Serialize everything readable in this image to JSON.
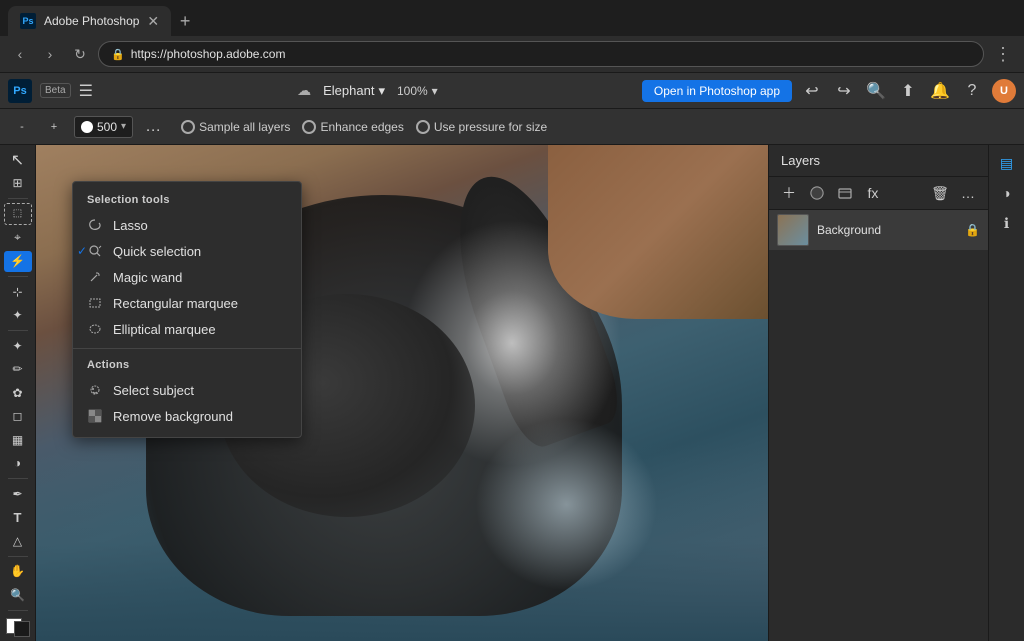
{
  "browser": {
    "tab_title": "Adobe Photoshop",
    "url": "https://photoshop.adobe.com",
    "new_tab_label": "+"
  },
  "header": {
    "ps_label": "Ps",
    "beta_label": "Beta",
    "file_name": "Elephant",
    "zoom_level": "100%",
    "open_app_btn": "Open in Photoshop app",
    "undo_icon": "↩",
    "redo_icon": "↪"
  },
  "toolbar": {
    "brush_size": "500",
    "sample_all_layers": "Sample all layers",
    "enhance_edges": "Enhance edges",
    "use_pressure": "Use pressure for size"
  },
  "selection_dropdown": {
    "section_title": "Selection tools",
    "items": [
      {
        "id": "lasso",
        "label": "Lasso",
        "checked": false
      },
      {
        "id": "quick-selection",
        "label": "Quick selection",
        "checked": true
      },
      {
        "id": "magic-wand",
        "label": "Magic wand",
        "checked": false
      },
      {
        "id": "rect-marquee",
        "label": "Rectangular marquee",
        "checked": false
      },
      {
        "id": "ellip-marquee",
        "label": "Elliptical marquee",
        "checked": false
      }
    ],
    "actions_title": "Actions",
    "actions": [
      {
        "id": "select-subject",
        "label": "Select subject"
      },
      {
        "id": "remove-bg",
        "label": "Remove background"
      }
    ]
  },
  "layers": {
    "title": "Layers",
    "items": [
      {
        "id": "background",
        "label": "Background",
        "locked": true
      }
    ]
  },
  "left_tools": [
    {
      "id": "select",
      "label": "▷",
      "active": false
    },
    {
      "id": "rectangle-select",
      "label": "⬚",
      "active": false
    },
    {
      "id": "lasso",
      "label": "⌖",
      "active": false
    },
    {
      "id": "quick-select",
      "label": "⚡",
      "active": true
    },
    {
      "id": "crop",
      "label": "⊹",
      "active": false
    },
    {
      "id": "eyedropper",
      "label": "💉",
      "active": false
    },
    {
      "id": "healing",
      "label": "✦",
      "active": false
    },
    {
      "id": "brush",
      "label": "🖌",
      "active": false
    },
    {
      "id": "clone",
      "label": "✿",
      "active": false
    },
    {
      "id": "eraser",
      "label": "◻",
      "active": false
    },
    {
      "id": "gradient",
      "label": "▦",
      "active": false
    },
    {
      "id": "dodge",
      "label": "◑",
      "active": false
    },
    {
      "id": "pen",
      "label": "✒",
      "active": false
    },
    {
      "id": "type",
      "label": "T",
      "active": false
    },
    {
      "id": "shape",
      "label": "△",
      "active": false
    },
    {
      "id": "hand",
      "label": "✋",
      "active": false
    },
    {
      "id": "zoom",
      "label": "🔍",
      "active": false
    }
  ],
  "right_icons": [
    {
      "id": "layers-panel",
      "label": "▤",
      "active": true
    },
    {
      "id": "adjustments",
      "label": "◑",
      "active": false
    },
    {
      "id": "properties",
      "label": "ℹ",
      "active": false
    }
  ]
}
